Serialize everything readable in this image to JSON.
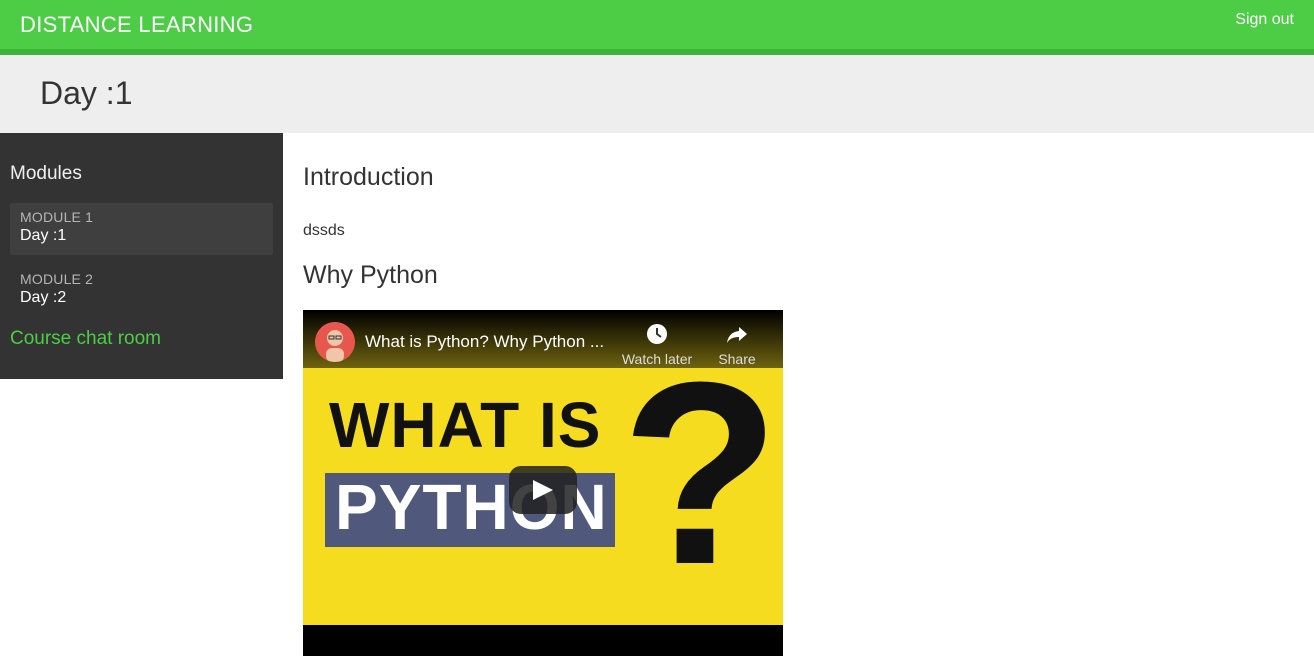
{
  "header": {
    "brand": "DISTANCE LEARNING",
    "signout_label": "Sign out",
    "accent_color": "#4ccd45"
  },
  "page": {
    "title": "Day :1"
  },
  "sidebar": {
    "heading": "Modules",
    "modules": [
      {
        "label": "MODULE 1",
        "day": "Day :1",
        "active": true
      },
      {
        "label": "MODULE 2",
        "day": "Day :2",
        "active": false
      }
    ],
    "chat_link": "Course chat room"
  },
  "content": {
    "section1_title": "Introduction",
    "section1_body": "dssds",
    "section2_title": "Why Python"
  },
  "video": {
    "title": "What is Python? Why Python ...",
    "watch_later": "Watch later",
    "share": "Share",
    "thumbnail_line1": "WHAT IS",
    "thumbnail_line2": "PYTHON",
    "thumbnail_symbol": "?",
    "icons": [
      "clock-icon",
      "share-arrow-icon",
      "play-icon"
    ]
  }
}
